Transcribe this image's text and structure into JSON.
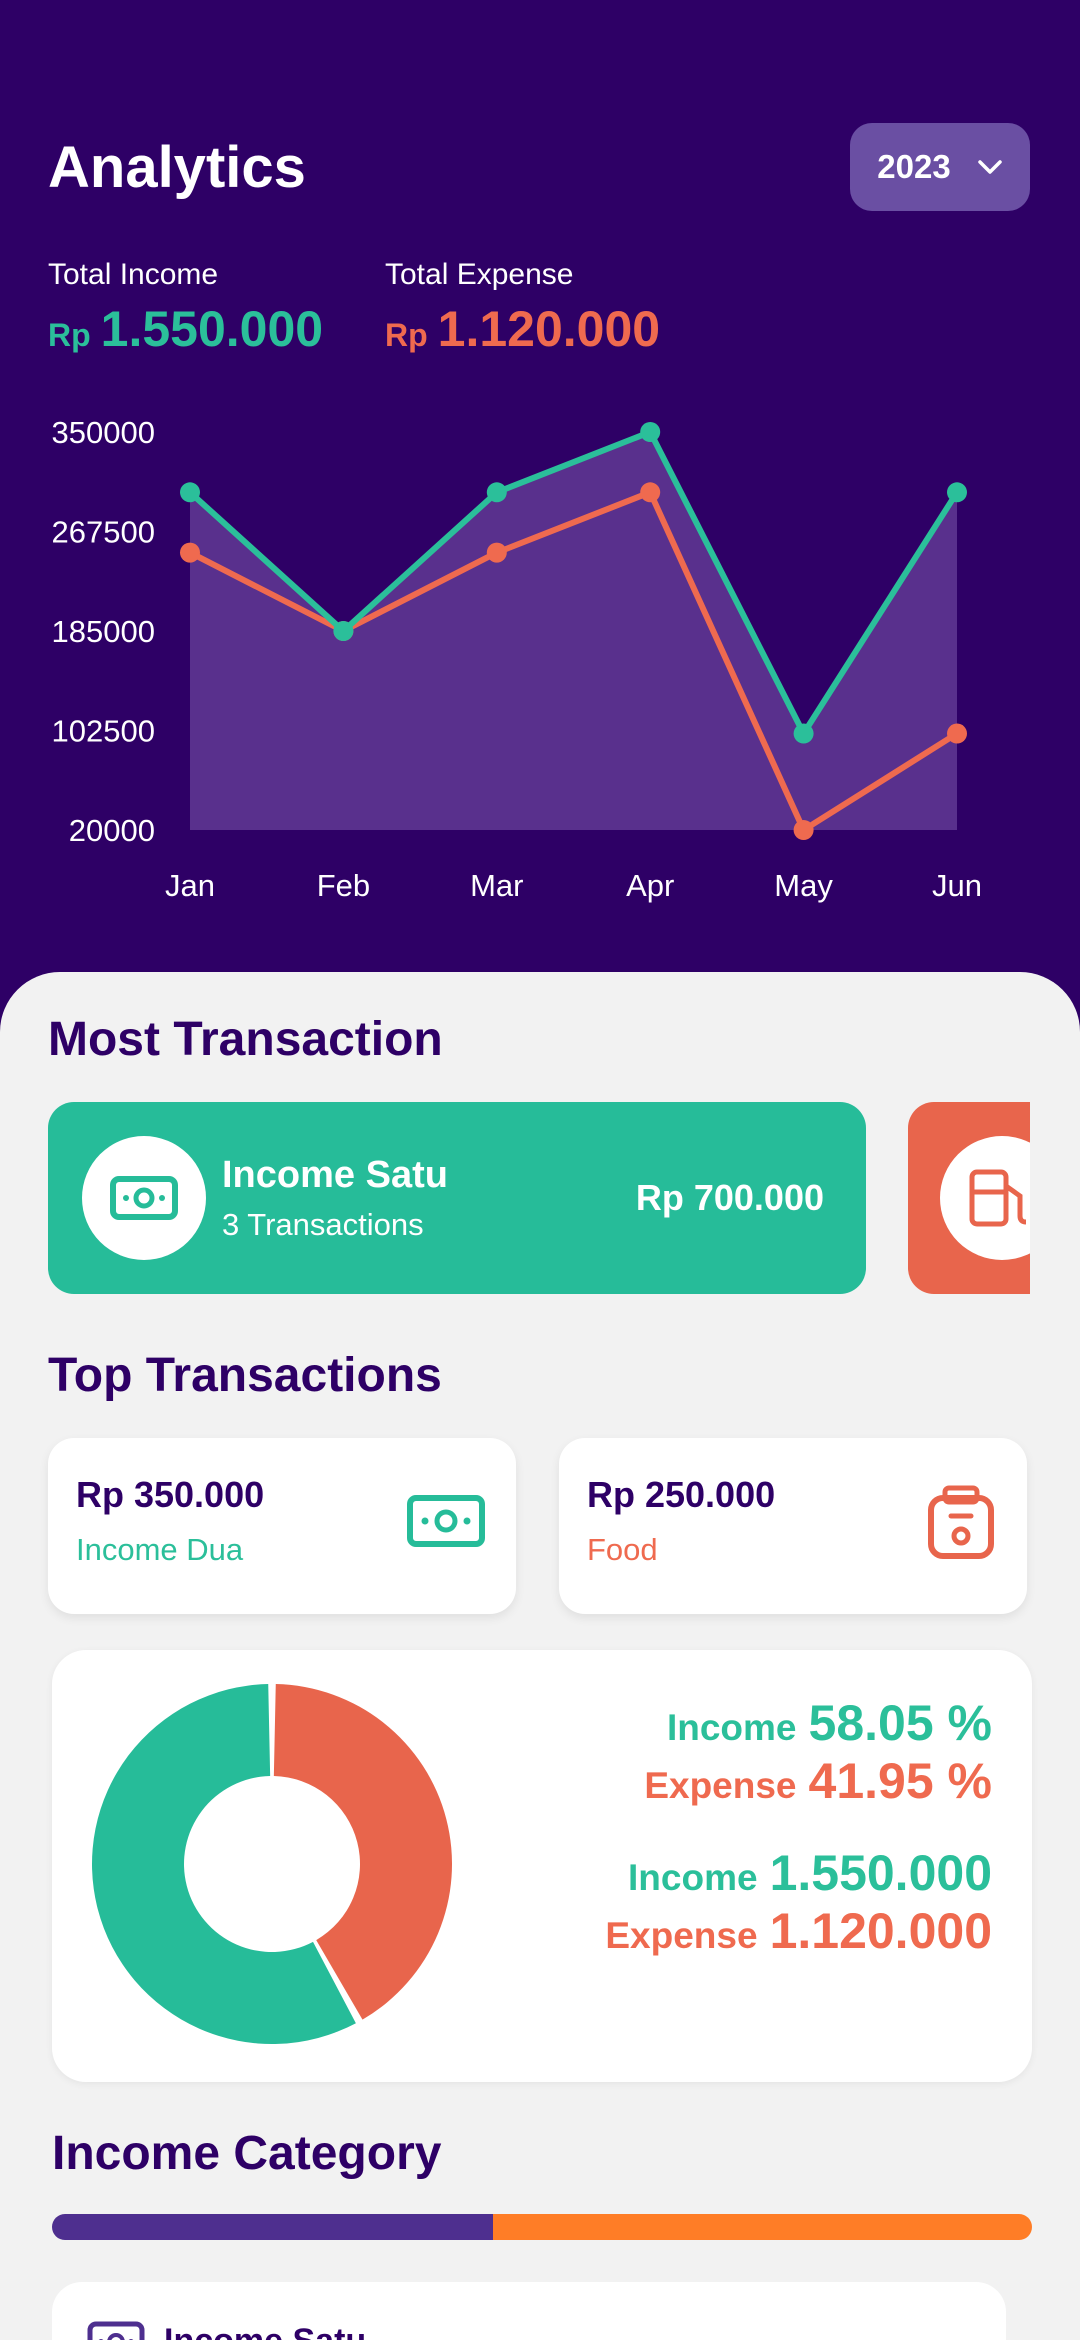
{
  "header": {
    "title": "Analytics",
    "year": "2023",
    "total_income": {
      "label": "Total Income",
      "currency": "Rp",
      "value": "1.550.000"
    },
    "total_expense": {
      "label": "Total Expense",
      "currency": "Rp",
      "value": "1.120.000"
    }
  },
  "chart_data": {
    "type": "line",
    "categories": [
      "Jan",
      "Feb",
      "Mar",
      "Apr",
      "May",
      "Jun"
    ],
    "y_ticks": [
      "350000",
      "267500",
      "185000",
      "102500",
      "20000"
    ],
    "ylim": [
      20000,
      350000
    ],
    "series": [
      {
        "color": "#2bbf9a",
        "values": [
          300000,
          185000,
          300000,
          350000,
          100000,
          300000
        ]
      },
      {
        "color": "#ef6a4f",
        "values": [
          250000,
          185000,
          250000,
          300000,
          20000,
          100000
        ]
      }
    ],
    "fill_color": "#5e3591",
    "grid": false
  },
  "most_transaction": {
    "title": "Most Transaction",
    "items": [
      {
        "name": "Income Satu",
        "count": "3 Transactions",
        "amount": "Rp 700.000",
        "color": "#26bc99",
        "icon": "money-icon"
      },
      {
        "color": "#e8654c",
        "icon": "gas-station-icon"
      }
    ]
  },
  "top_transactions": {
    "title": "Top Transactions",
    "items": [
      {
        "amount": "Rp 350.000",
        "category": "Income Dua",
        "color": "#26bc99",
        "icon": "money-icon"
      },
      {
        "amount": "Rp 250.000",
        "category": "Food",
        "color": "#e8654c",
        "icon": "food-bag-icon"
      }
    ]
  },
  "ratio": {
    "income_label": "Income",
    "expense_label": "Expense",
    "income_percent": "58.05 %",
    "expense_percent": "41.95 %",
    "income_value": "1.550.000",
    "expense_value": "1.120.000",
    "income_share": 58.05,
    "expense_share": 41.95,
    "income_color": "#26bc99",
    "expense_color": "#e8654c"
  },
  "income_category": {
    "title": "Income Category",
    "share_primary": 0.45,
    "colors": [
      "#4e2f8f",
      "#ff7d26"
    ],
    "items": [
      {
        "name": "Income Satu",
        "icon": "money-icon"
      }
    ]
  }
}
